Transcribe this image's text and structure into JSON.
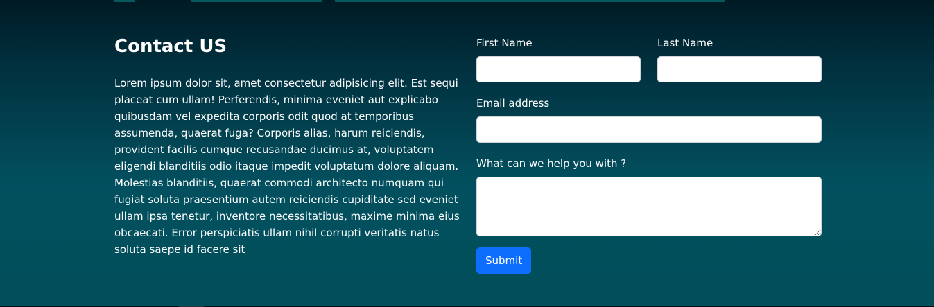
{
  "contact": {
    "heading": "Contact US",
    "description": "Lorem ipsum dolor sit, amet consectetur adipisicing elit. Est sequi placeat cum ullam! Perferendis, minima eveniet aut explicabo quibusdam vel expedita corporis odit quod at temporibus assumenda, quaerat fuga? Corporis alias, harum reiciendis, provident facilis cumque recusandae ducimus at, voluptatem eligendi blanditiis odio itaque impedit voluptatum dolore aliquam. Molestias blanditiis, quaerat commodi architecto numquam qui fugiat soluta praesentium autem reiciendis cupiditate sed eveniet ullam ipsa tenetur, inventore necessitatibus, maxime minima eius obcaecati. Error perspiciatis ullam nihil corrupti veritatis natus soluta saepe id facere sit"
  },
  "form": {
    "first_name_label": "First Name",
    "first_name_value": "",
    "last_name_label": "Last Name",
    "last_name_value": "",
    "email_label": "Email address",
    "email_value": "",
    "help_label": "What can we help you with ?",
    "help_value": "",
    "submit_label": "Submit"
  },
  "colors": {
    "background_top": "#001a24",
    "background_bottom": "#024e5a",
    "button": "#0d6efd",
    "text": "#ffffff"
  }
}
